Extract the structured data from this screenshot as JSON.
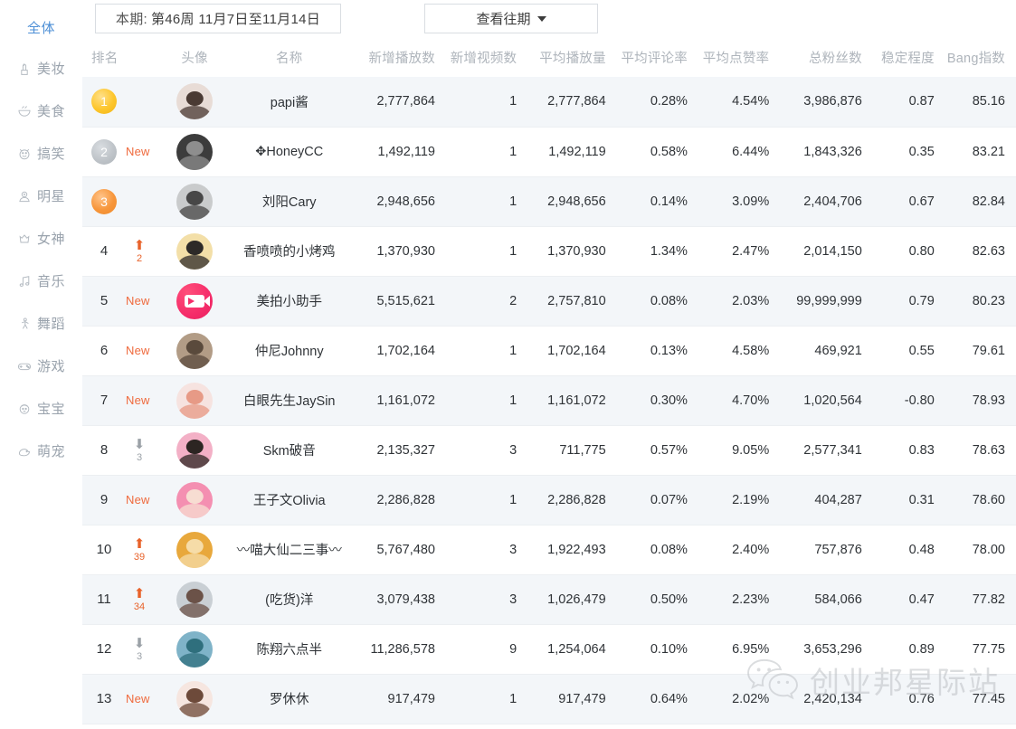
{
  "sidebar": {
    "items": [
      {
        "label": "全体",
        "icon": "none-icon",
        "active": true
      },
      {
        "label": "美妆",
        "icon": "lipstick-icon",
        "active": false
      },
      {
        "label": "美食",
        "icon": "bowl-icon",
        "active": false
      },
      {
        "label": "搞笑",
        "icon": "smiley-icon",
        "active": false
      },
      {
        "label": "明星",
        "icon": "star-person-icon",
        "active": false
      },
      {
        "label": "女神",
        "icon": "goddess-icon",
        "active": false
      },
      {
        "label": "音乐",
        "icon": "music-note-icon",
        "active": false
      },
      {
        "label": "舞蹈",
        "icon": "dance-icon",
        "active": false
      },
      {
        "label": "游戏",
        "icon": "gamepad-icon",
        "active": false
      },
      {
        "label": "宝宝",
        "icon": "baby-icon",
        "active": false
      },
      {
        "label": "萌宠",
        "icon": "pet-icon",
        "active": false
      }
    ]
  },
  "toolbar": {
    "period_label": "本期:",
    "period_value": "第46周 11月7日至11月14日",
    "history_button": "查看往期",
    "history_caret_icon": "chevron-down-icon"
  },
  "table": {
    "headers": [
      "排名",
      "头像",
      "名称",
      "新增播放数",
      "新增视频数",
      "平均播放量",
      "平均评论率",
      "平均点赞率",
      "总粉丝数",
      "稳定程度",
      "Bang指数"
    ],
    "rows": [
      {
        "rank": "1",
        "medal": "gold",
        "change_type": "none",
        "change_value": "",
        "avatar_colors": [
          "#e8dcd6",
          "#4a3a33"
        ],
        "avatar_kind": "photo",
        "name": "papi酱",
        "new_plays": "2,777,864",
        "new_videos": "1",
        "avg_plays": "2,777,864",
        "avg_comment_rate": "0.28%",
        "avg_like_rate": "4.54%",
        "total_fans": "3,986,876",
        "stability": "0.87",
        "bang_index": "85.16"
      },
      {
        "rank": "2",
        "medal": "silver",
        "change_type": "new",
        "change_value": "New",
        "avatar_colors": [
          "#3c3c3c",
          "#8e8e8e"
        ],
        "avatar_kind": "photo",
        "name": "✥HoneyCC",
        "new_plays": "1,492,119",
        "new_videos": "1",
        "avg_plays": "1,492,119",
        "avg_comment_rate": "0.58%",
        "avg_like_rate": "6.44%",
        "total_fans": "1,843,326",
        "stability": "0.35",
        "bang_index": "83.21"
      },
      {
        "rank": "3",
        "medal": "bronze",
        "change_type": "none",
        "change_value": "",
        "avatar_colors": [
          "#c9cbcc",
          "#474747"
        ],
        "avatar_kind": "photo",
        "name": "刘阳Cary",
        "new_plays": "2,948,656",
        "new_videos": "1",
        "avg_plays": "2,948,656",
        "avg_comment_rate": "0.14%",
        "avg_like_rate": "3.09%",
        "total_fans": "2,404,706",
        "stability": "0.67",
        "bang_index": "82.84"
      },
      {
        "rank": "4",
        "medal": "none",
        "change_type": "up",
        "change_value": "2",
        "avatar_colors": [
          "#f3dfa8",
          "#2d2a28"
        ],
        "avatar_kind": "photo",
        "name": "香喷喷的小烤鸡",
        "new_plays": "1,370,930",
        "new_videos": "1",
        "avg_plays": "1,370,930",
        "avg_comment_rate": "1.34%",
        "avg_like_rate": "2.47%",
        "total_fans": "2,014,150",
        "stability": "0.80",
        "bang_index": "82.63"
      },
      {
        "rank": "5",
        "medal": "none",
        "change_type": "new",
        "change_value": "New",
        "avatar_colors": [
          "#f52d6a",
          "#ffffff"
        ],
        "avatar_kind": "meipai-logo",
        "name": "美拍小助手",
        "new_plays": "5,515,621",
        "new_videos": "2",
        "avg_plays": "2,757,810",
        "avg_comment_rate": "0.08%",
        "avg_like_rate": "2.03%",
        "total_fans": "99,999,999",
        "stability": "0.79",
        "bang_index": "80.23"
      },
      {
        "rank": "6",
        "medal": "none",
        "change_type": "new",
        "change_value": "New",
        "avatar_colors": [
          "#b29c86",
          "#5a4a3c"
        ],
        "avatar_kind": "photo",
        "name": "仲尼Johnny",
        "new_plays": "1,702,164",
        "new_videos": "1",
        "avg_plays": "1,702,164",
        "avg_comment_rate": "0.13%",
        "avg_like_rate": "4.58%",
        "total_fans": "469,921",
        "stability": "0.55",
        "bang_index": "79.61"
      },
      {
        "rank": "7",
        "medal": "none",
        "change_type": "new",
        "change_value": "New",
        "avatar_colors": [
          "#f6e3e0",
          "#e79a86"
        ],
        "avatar_kind": "photo",
        "name": "白眼先生JaySin",
        "new_plays": "1,161,072",
        "new_videos": "1",
        "avg_plays": "1,161,072",
        "avg_comment_rate": "0.30%",
        "avg_like_rate": "4.70%",
        "total_fans": "1,020,564",
        "stability": "-0.80",
        "bang_index": "78.93"
      },
      {
        "rank": "8",
        "medal": "none",
        "change_type": "down",
        "change_value": "3",
        "avatar_colors": [
          "#f3b0c6",
          "#2c2522"
        ],
        "avatar_kind": "photo",
        "name": "Skm破音",
        "new_plays": "2,135,327",
        "new_videos": "3",
        "avg_plays": "711,775",
        "avg_comment_rate": "0.57%",
        "avg_like_rate": "9.05%",
        "total_fans": "2,577,341",
        "stability": "0.83",
        "bang_index": "78.63"
      },
      {
        "rank": "9",
        "medal": "none",
        "change_type": "new",
        "change_value": "New",
        "avatar_colors": [
          "#f48fb1",
          "#f7ddd2"
        ],
        "avatar_kind": "photo",
        "name": "王子文Olivia",
        "new_plays": "2,286,828",
        "new_videos": "1",
        "avg_plays": "2,286,828",
        "avg_comment_rate": "0.07%",
        "avg_like_rate": "2.19%",
        "total_fans": "404,287",
        "stability": "0.31",
        "bang_index": "78.60"
      },
      {
        "rank": "10",
        "medal": "none",
        "change_type": "up",
        "change_value": "39",
        "avatar_colors": [
          "#e8a83c",
          "#f6dca8"
        ],
        "avatar_kind": "photo",
        "name": "〰喵大仙二三事〰",
        "new_plays": "5,767,480",
        "new_videos": "3",
        "avg_plays": "1,922,493",
        "avg_comment_rate": "0.08%",
        "avg_like_rate": "2.40%",
        "total_fans": "757,876",
        "stability": "0.48",
        "bang_index": "78.00"
      },
      {
        "rank": "11",
        "medal": "none",
        "change_type": "up",
        "change_value": "34",
        "avatar_colors": [
          "#c9cfd4",
          "#6b5248"
        ],
        "avatar_kind": "photo",
        "name": "(吃货)洋",
        "new_plays": "3,079,438",
        "new_videos": "3",
        "avg_plays": "1,026,479",
        "avg_comment_rate": "0.50%",
        "avg_like_rate": "2.23%",
        "total_fans": "584,066",
        "stability": "0.47",
        "bang_index": "77.82"
      },
      {
        "rank": "12",
        "medal": "none",
        "change_type": "down",
        "change_value": "3",
        "avatar_colors": [
          "#7fb3c8",
          "#2f6f7d"
        ],
        "avatar_kind": "photo",
        "name": "陈翔六点半",
        "new_plays": "11,286,578",
        "new_videos": "9",
        "avg_plays": "1,254,064",
        "avg_comment_rate": "0.10%",
        "avg_like_rate": "6.95%",
        "total_fans": "3,653,296",
        "stability": "0.89",
        "bang_index": "77.75"
      },
      {
        "rank": "13",
        "medal": "none",
        "change_type": "new",
        "change_value": "New",
        "avatar_colors": [
          "#f6e6e0",
          "#6d4a3a"
        ],
        "avatar_kind": "photo",
        "name": "罗休休",
        "new_plays": "917,479",
        "new_videos": "1",
        "avg_plays": "917,479",
        "avg_comment_rate": "0.64%",
        "avg_like_rate": "2.02%",
        "total_fans": "2,420,134",
        "stability": "0.76",
        "bang_index": "77.45"
      }
    ]
  },
  "watermark": {
    "text": "创业邦星际站",
    "logo_icon": "wechat-icon"
  },
  "colors": {
    "accent_blue": "#4a8fd4",
    "new_orange": "#ef6a3d",
    "up_orange": "#e8622a",
    "down_gray": "#9ba1a7",
    "row_alt": "#f3f6f9"
  }
}
